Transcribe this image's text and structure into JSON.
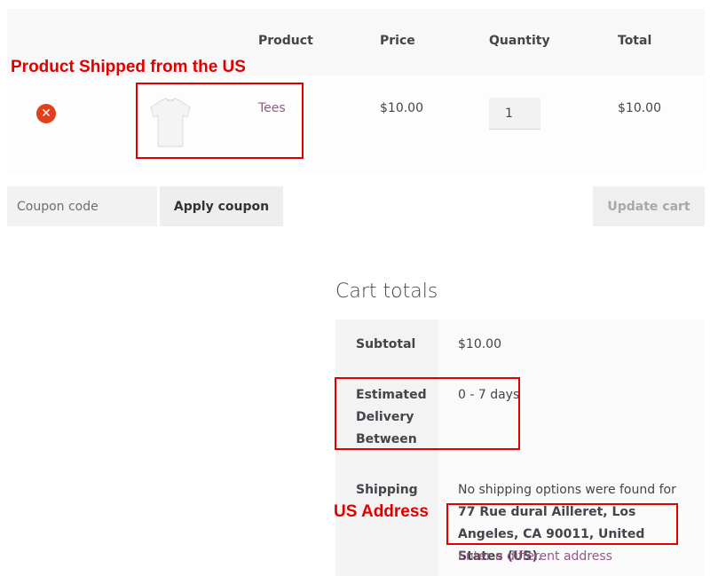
{
  "table": {
    "headers": {
      "product": "Product",
      "price": "Price",
      "quantity": "Quantity",
      "total": "Total"
    },
    "rows": [
      {
        "remove_icon": "remove-icon",
        "product_name": "Tees",
        "price": "$10.00",
        "quantity": "1",
        "total": "$10.00"
      }
    ]
  },
  "coupon": {
    "placeholder": "Coupon code",
    "apply_label": "Apply coupon"
  },
  "update_cart_label": "Update cart",
  "totals": {
    "title": "Cart totals",
    "subtotal_label": "Subtotal",
    "subtotal_value": "$10.00",
    "delivery_label": "Estimated Delivery Between",
    "delivery_value": "0 - 7 days",
    "shipping_label": "Shipping",
    "shipping_text_pre": "No shipping options were found for ",
    "shipping_address": "77 Rue dural Ailleret, Los Angeles, CA 90011, United States (US)",
    "shipping_text_post": ".",
    "change_address_label": "Enter a different address"
  },
  "annotations": {
    "product_label": "Product Shipped from the US",
    "address_label": "US Address",
    "color": "#e00000"
  },
  "colors": {
    "link": "#96588a",
    "remove": "#e2401c"
  }
}
